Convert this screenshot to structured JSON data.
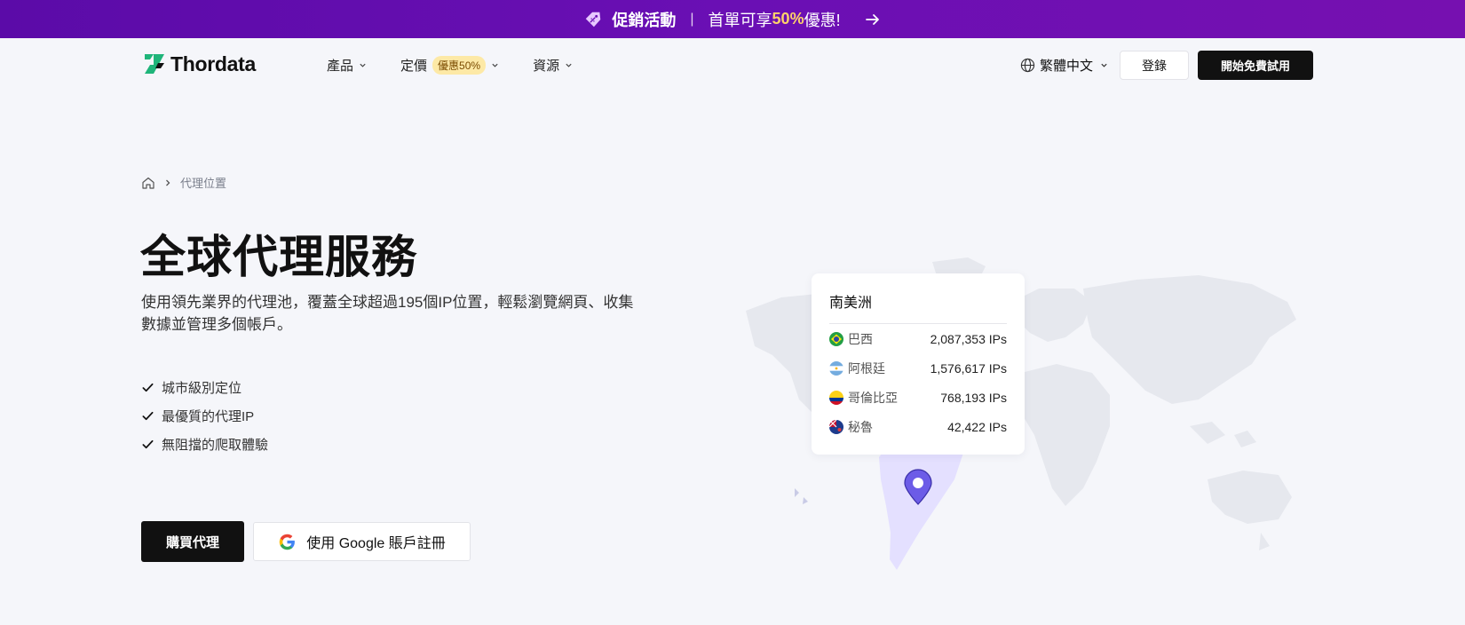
{
  "promo": {
    "title": "促銷活動",
    "separator": "|",
    "text_prefix": "首單可享 ",
    "highlight": "50%",
    "text_suffix": " 優惠!",
    "gradient_colors": [
      "#5b0ba8",
      "#7610b0"
    ]
  },
  "header": {
    "logo_text": "Thordata",
    "nav": [
      {
        "label": "產品",
        "icon": "chevron-down-icon"
      },
      {
        "label": "定價",
        "badge": "優惠50%",
        "icon": "chevron-down-icon"
      },
      {
        "label": "資源",
        "icon": "chevron-down-icon"
      }
    ],
    "language": "繁體中文",
    "login_label": "登錄",
    "trial_label": "開始免費試用"
  },
  "breadcrumb": {
    "current": "代理位置"
  },
  "hero": {
    "title": "全球代理服務",
    "description": "使用領先業界的代理池，覆蓋全球超過195個IP位置，輕鬆瀏覽網頁、收集數據並管理多個帳戶。",
    "features": [
      "城市級別定位",
      "最優質的代理IP",
      "無阻擋的爬取體驗"
    ],
    "buy_label": "購買代理",
    "google_label": "使用 Google 賬戶註冊"
  },
  "region": {
    "title": "南美洲",
    "countries": [
      {
        "name": "巴西",
        "ips": "2,087,353 IPs",
        "flag": "brazil-flag-icon"
      },
      {
        "name": "阿根廷",
        "ips": "1,576,617 IPs",
        "flag": "argentina-flag-icon"
      },
      {
        "name": "哥倫比亞",
        "ips": "768,193 IPs",
        "flag": "colombia-flag-icon"
      },
      {
        "name": "秘魯",
        "ips": "42,422 IPs",
        "flag": "peru-flag-icon"
      }
    ]
  },
  "colors": {
    "accent": "#6c5ce7",
    "dark_button": "#111111",
    "logo_green": "#1fb57a",
    "highlight": "#ffd36a"
  }
}
